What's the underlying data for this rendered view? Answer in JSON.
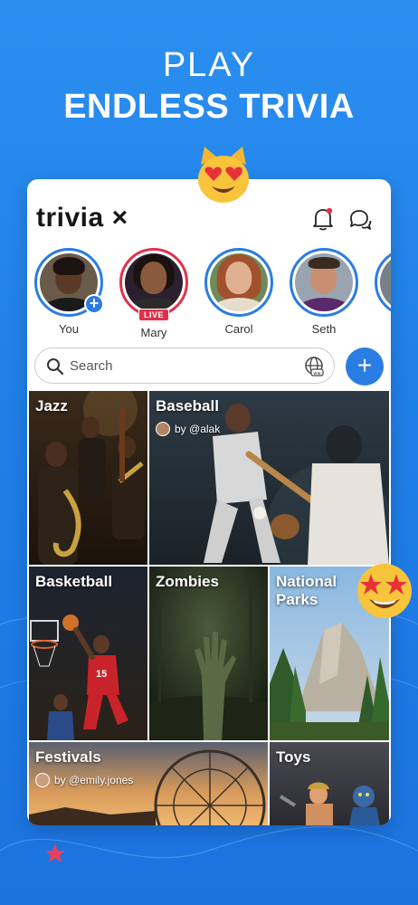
{
  "promo": {
    "line1": "PLAY",
    "line2": "ENDLESS TRIVIA"
  },
  "app": {
    "logo_text": "trivia",
    "logo_mark": "×"
  },
  "stories": [
    {
      "name": "You",
      "badge": "+"
    },
    {
      "name": "Mary",
      "badge": "LIVE"
    },
    {
      "name": "Carol"
    },
    {
      "name": "Seth"
    }
  ],
  "search": {
    "placeholder": "Search",
    "add_label": "+"
  },
  "tiles": [
    {
      "title": "Jazz"
    },
    {
      "title": "Baseball",
      "by": "by @alak"
    },
    {
      "title": "Basketball"
    },
    {
      "title": "Zombies"
    },
    {
      "title_line1": "National",
      "title_line2": "Parks"
    },
    {
      "title": "Festivals",
      "by": "by @emily.jones"
    },
    {
      "title": "Toys"
    }
  ],
  "colors": {
    "background": "#1f7fe8",
    "accent": "#2a7de1",
    "live": "#e0324b"
  },
  "icons": [
    "bell-icon",
    "chat-icon",
    "search-icon",
    "globe-icon",
    "plus-icon",
    "heart-eyes-cat-emoji",
    "star-struck-emoji",
    "star-icon"
  ]
}
